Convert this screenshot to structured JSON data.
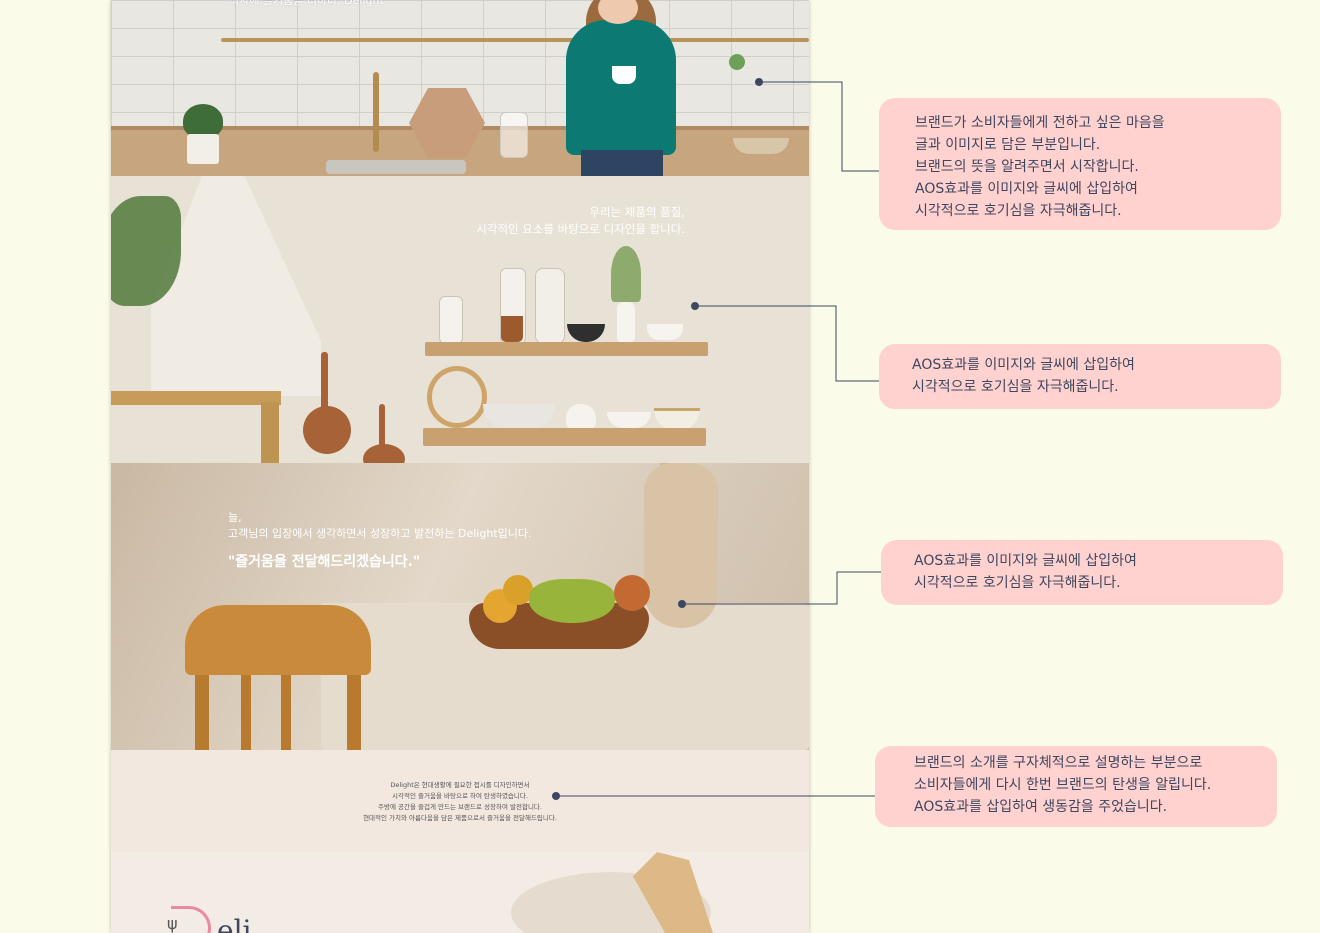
{
  "mockup": {
    "section1": {
      "text": "식사에 즐거움을 더하다, Delight"
    },
    "section2": {
      "lines": [
        "우리는 제품의 품질,",
        "시각적인 요소를 바탕으로 디자인을 합니다."
      ]
    },
    "section3": {
      "lines": [
        "늘,",
        "고객님의 입장에서 생각하면서 성장하고 발전하는 Delight입니다."
      ],
      "quote": "\"즐거움을 전달해드리겠습니다.\""
    },
    "section4": {
      "lines": [
        "Delight은 현대생활에 필요한 접시를 디자인하면서",
        "시각적인 즐거움을 바탕으로 하여 탄생하였습니다.",
        "주방에 공간을 즐겁게 만드는 브랜드로 성장하여 발전합니다.",
        "현대적인 가치와 아름다움을 담은 제품으로서 즐거움을 전달해드립니다."
      ]
    },
    "section5": {
      "logo_text": "eli"
    }
  },
  "annotations": [
    {
      "lines": [
        "브랜드가 소비자들에게 전하고 싶은 마음을",
        "글과 이미지로 담은 부분입니다.",
        "브랜드의 뜻을 알려주면서 시작합니다.",
        "AOS효과를 이미지와 글씨에 삽입하여",
        "시각적으로 호기심을 자극해줍니다."
      ]
    },
    {
      "lines": [
        "AOS효과를 이미지와 글씨에 삽입하여",
        "시각적으로 호기심을 자극해줍니다."
      ]
    },
    {
      "lines": [
        "AOS효과를 이미지와 글씨에 삽입하여",
        "시각적으로 호기심을 자극해줍니다."
      ]
    },
    {
      "lines": [
        "브랜드의 소개를 구자체적으로 설명하는 부분으로",
        "소비자들에게 다시 한번 브랜드의 탄생을 알립니다.",
        "AOS효과를 삽입하여 생동감을 주었습니다."
      ]
    }
  ],
  "colors": {
    "background": "#fbfbe9",
    "note_bg": "#ffd1cf",
    "note_text": "#3d4760",
    "connector": "#3d4760"
  }
}
